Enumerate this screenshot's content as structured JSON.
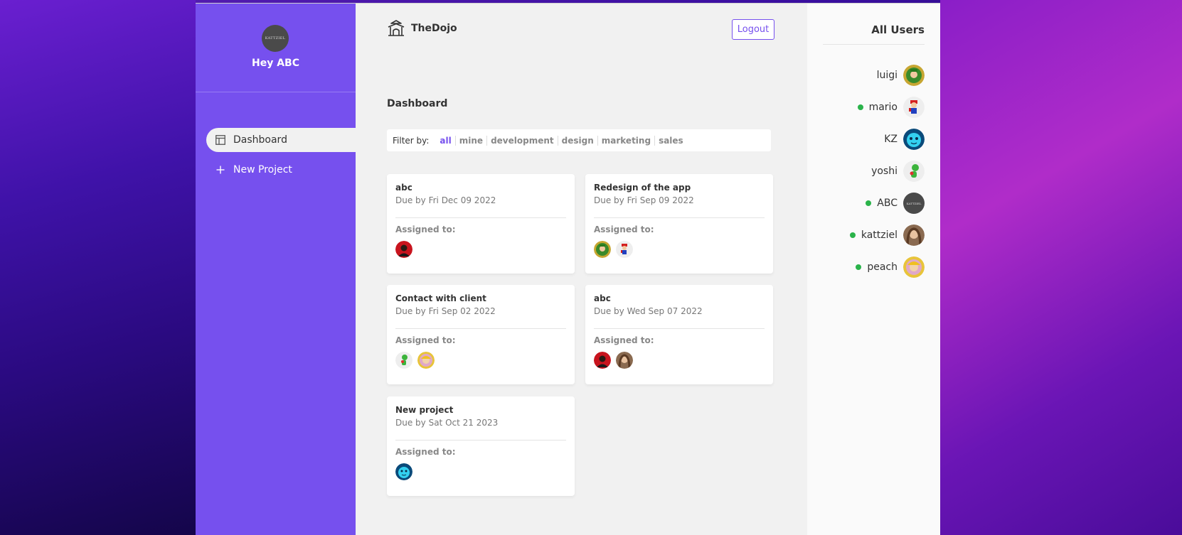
{
  "sidebar": {
    "avatar_text": "KATTZIEL",
    "greeting": "Hey ABC",
    "nav": [
      {
        "label": "Dashboard",
        "icon": "dashboard-icon",
        "active": true
      },
      {
        "label": "New Project",
        "icon": "plus-icon",
        "active": false
      }
    ]
  },
  "header": {
    "logo_text": "TheDojo",
    "logout_label": "Logout"
  },
  "main": {
    "title": "Dashboard",
    "filter": {
      "label": "Filter by:",
      "options": [
        "all",
        "mine",
        "development",
        "design",
        "marketing",
        "sales"
      ],
      "selected": "all"
    },
    "projects": [
      {
        "name": "abc",
        "due": "Due by Fri Dec 09 2022",
        "assigned_label": "Assigned to:",
        "assignees": [
          "red-user"
        ]
      },
      {
        "name": "Redesign of the app",
        "due": "Due by Fri Sep 09 2022",
        "assigned_label": "Assigned to:",
        "assignees": [
          "luigi",
          "mario"
        ]
      },
      {
        "name": "Contact with client",
        "due": "Due by Fri Sep 02 2022",
        "assigned_label": "Assigned to:",
        "assignees": [
          "yoshi",
          "peach"
        ]
      },
      {
        "name": "abc",
        "due": "Due by Wed Sep 07 2022",
        "assigned_label": "Assigned to:",
        "assignees": [
          "red-user",
          "kattziel"
        ]
      },
      {
        "name": "New project",
        "due": "Due by Sat Oct 21 2023",
        "assigned_label": "Assigned to:",
        "assignees": [
          "KZ"
        ]
      }
    ]
  },
  "users_panel": {
    "title": "All Users",
    "users": [
      {
        "name": "luigi",
        "online": false
      },
      {
        "name": "mario",
        "online": true
      },
      {
        "name": "KZ",
        "online": false
      },
      {
        "name": "yoshi",
        "online": false
      },
      {
        "name": "ABC",
        "online": true
      },
      {
        "name": "kattziel",
        "online": true
      },
      {
        "name": "peach",
        "online": true
      }
    ]
  },
  "colors": {
    "primary": "#7650ee",
    "online": "#2ab34a",
    "background": "#f1f1f1"
  }
}
